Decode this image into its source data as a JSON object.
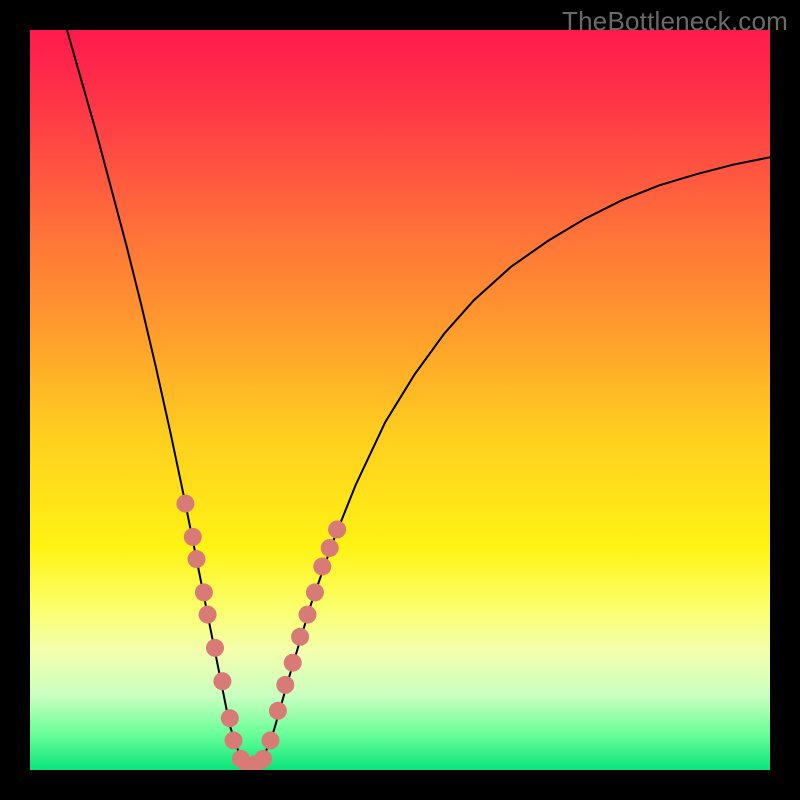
{
  "watermark": "TheBottleneck.com",
  "chart_data": {
    "type": "line",
    "title": "",
    "xlabel": "",
    "ylabel": "",
    "xlim": [
      0,
      100
    ],
    "ylim": [
      0,
      100
    ],
    "grid": false,
    "background": {
      "type": "vertical-gradient",
      "stops": [
        {
          "offset": 0.0,
          "color": "#ff1a4d"
        },
        {
          "offset": 0.1,
          "color": "#ff3547"
        },
        {
          "offset": 0.25,
          "color": "#ff6a3b"
        },
        {
          "offset": 0.4,
          "color": "#ff9a2e"
        },
        {
          "offset": 0.55,
          "color": "#ffcf1f"
        },
        {
          "offset": 0.7,
          "color": "#fff314"
        },
        {
          "offset": 0.78,
          "color": "#fbff6b"
        },
        {
          "offset": 0.84,
          "color": "#f3ffae"
        },
        {
          "offset": 0.9,
          "color": "#c9ffc0"
        },
        {
          "offset": 0.95,
          "color": "#6cff9a"
        },
        {
          "offset": 1.0,
          "color": "#09e57a"
        }
      ]
    },
    "series": [
      {
        "name": "bottleneck-curve",
        "color": "#000000",
        "width": 2,
        "x": [
          5.0,
          7.0,
          9.0,
          11.0,
          13.0,
          15.0,
          17.0,
          19.0,
          21.0,
          22.5,
          24.0,
          25.5,
          27.0,
          28.5,
          30.0,
          31.5,
          33.0,
          35.0,
          38.0,
          41.0,
          44.0,
          48.0,
          52.0,
          56.0,
          60.0,
          65.0,
          70.0,
          75.0,
          80.0,
          85.0,
          90.0,
          95.0,
          100.0
        ],
        "y": [
          100.0,
          93.0,
          86.0,
          78.5,
          71.0,
          63.0,
          54.5,
          45.5,
          36.0,
          28.5,
          21.0,
          13.5,
          6.0,
          1.5,
          0.5,
          1.5,
          5.5,
          12.5,
          22.5,
          31.0,
          38.5,
          47.0,
          53.5,
          59.0,
          63.5,
          68.0,
          71.5,
          74.5,
          77.0,
          79.0,
          80.5,
          81.8,
          82.8
        ]
      }
    ],
    "markers": {
      "name": "highlight-dots",
      "color": "#d87b76",
      "radius": 9,
      "points": [
        {
          "x": 21.0,
          "y": 36.0
        },
        {
          "x": 22.0,
          "y": 31.5
        },
        {
          "x": 22.5,
          "y": 28.5
        },
        {
          "x": 23.5,
          "y": 24.0
        },
        {
          "x": 24.0,
          "y": 21.0
        },
        {
          "x": 25.0,
          "y": 16.5
        },
        {
          "x": 26.0,
          "y": 12.0
        },
        {
          "x": 27.0,
          "y": 7.0
        },
        {
          "x": 27.5,
          "y": 4.0
        },
        {
          "x": 28.5,
          "y": 1.5
        },
        {
          "x": 29.5,
          "y": 0.6
        },
        {
          "x": 30.5,
          "y": 0.8
        },
        {
          "x": 31.5,
          "y": 1.5
        },
        {
          "x": 32.5,
          "y": 4.0
        },
        {
          "x": 33.5,
          "y": 8.0
        },
        {
          "x": 34.5,
          "y": 11.5
        },
        {
          "x": 35.5,
          "y": 14.5
        },
        {
          "x": 36.5,
          "y": 18.0
        },
        {
          "x": 37.5,
          "y": 21.0
        },
        {
          "x": 38.5,
          "y": 24.0
        },
        {
          "x": 39.5,
          "y": 27.5
        },
        {
          "x": 40.5,
          "y": 30.0
        },
        {
          "x": 41.5,
          "y": 32.5
        }
      ]
    }
  }
}
